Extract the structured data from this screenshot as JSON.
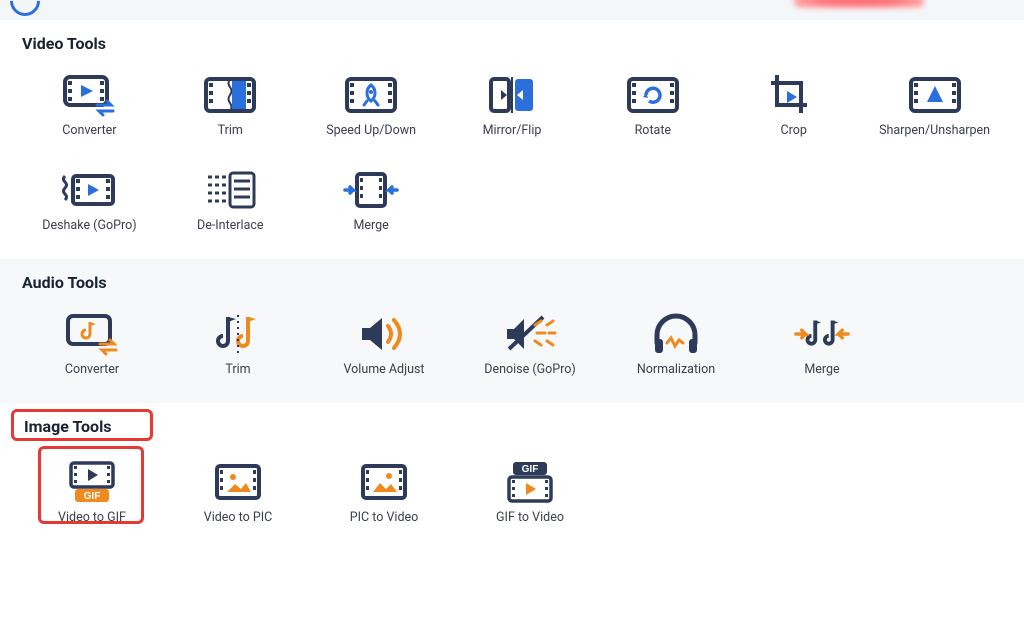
{
  "colors": {
    "navy": "#2e3a5a",
    "blue": "#2a6fdb",
    "orange": "#ef8a1f",
    "red": "#e53935"
  },
  "sections": {
    "video": {
      "title": "Video Tools",
      "tools": [
        {
          "id": "v-converter",
          "label": "Converter",
          "icon": "film-play-swap"
        },
        {
          "id": "v-trim",
          "label": "Trim",
          "icon": "film-trim"
        },
        {
          "id": "v-speed",
          "label": "Speed Up/Down",
          "icon": "film-rocket"
        },
        {
          "id": "v-mirror",
          "label": "Mirror/Flip",
          "icon": "mirror-flip"
        },
        {
          "id": "v-rotate",
          "label": "Rotate",
          "icon": "film-rotate"
        },
        {
          "id": "v-crop",
          "label": "Crop",
          "icon": "crop"
        },
        {
          "id": "v-sharpen",
          "label": "Sharpen/Unsharpen",
          "icon": "film-triangle"
        },
        {
          "id": "v-deshake",
          "label": "Deshake (GoPro)",
          "icon": "deshake"
        },
        {
          "id": "v-deinterlace",
          "label": "De-Interlace",
          "icon": "deinterlace"
        },
        {
          "id": "v-merge",
          "label": "Merge",
          "icon": "film-merge"
        }
      ]
    },
    "audio": {
      "title": "Audio Tools",
      "tools": [
        {
          "id": "a-converter",
          "label": "Converter",
          "icon": "audio-converter"
        },
        {
          "id": "a-trim",
          "label": "Trim",
          "icon": "audio-trim"
        },
        {
          "id": "a-volume",
          "label": "Volume Adjust",
          "icon": "volume"
        },
        {
          "id": "a-denoise",
          "label": "Denoise (GoPro)",
          "icon": "denoise"
        },
        {
          "id": "a-normalize",
          "label": "Normalization",
          "icon": "headphones"
        },
        {
          "id": "a-merge",
          "label": "Merge",
          "icon": "audio-merge"
        }
      ]
    },
    "image": {
      "title": "Image Tools",
      "tools": [
        {
          "id": "i-vid2gif",
          "label": "Video to GIF",
          "icon": "video-to-gif"
        },
        {
          "id": "i-vid2pic",
          "label": "Video to PIC",
          "icon": "film-photo"
        },
        {
          "id": "i-pic2vid",
          "label": "PIC to Video",
          "icon": "film-picture"
        },
        {
          "id": "i-gif2vid",
          "label": "GIF to Video",
          "icon": "gif-to-video"
        }
      ],
      "highlighted": "i-vid2gif"
    }
  }
}
